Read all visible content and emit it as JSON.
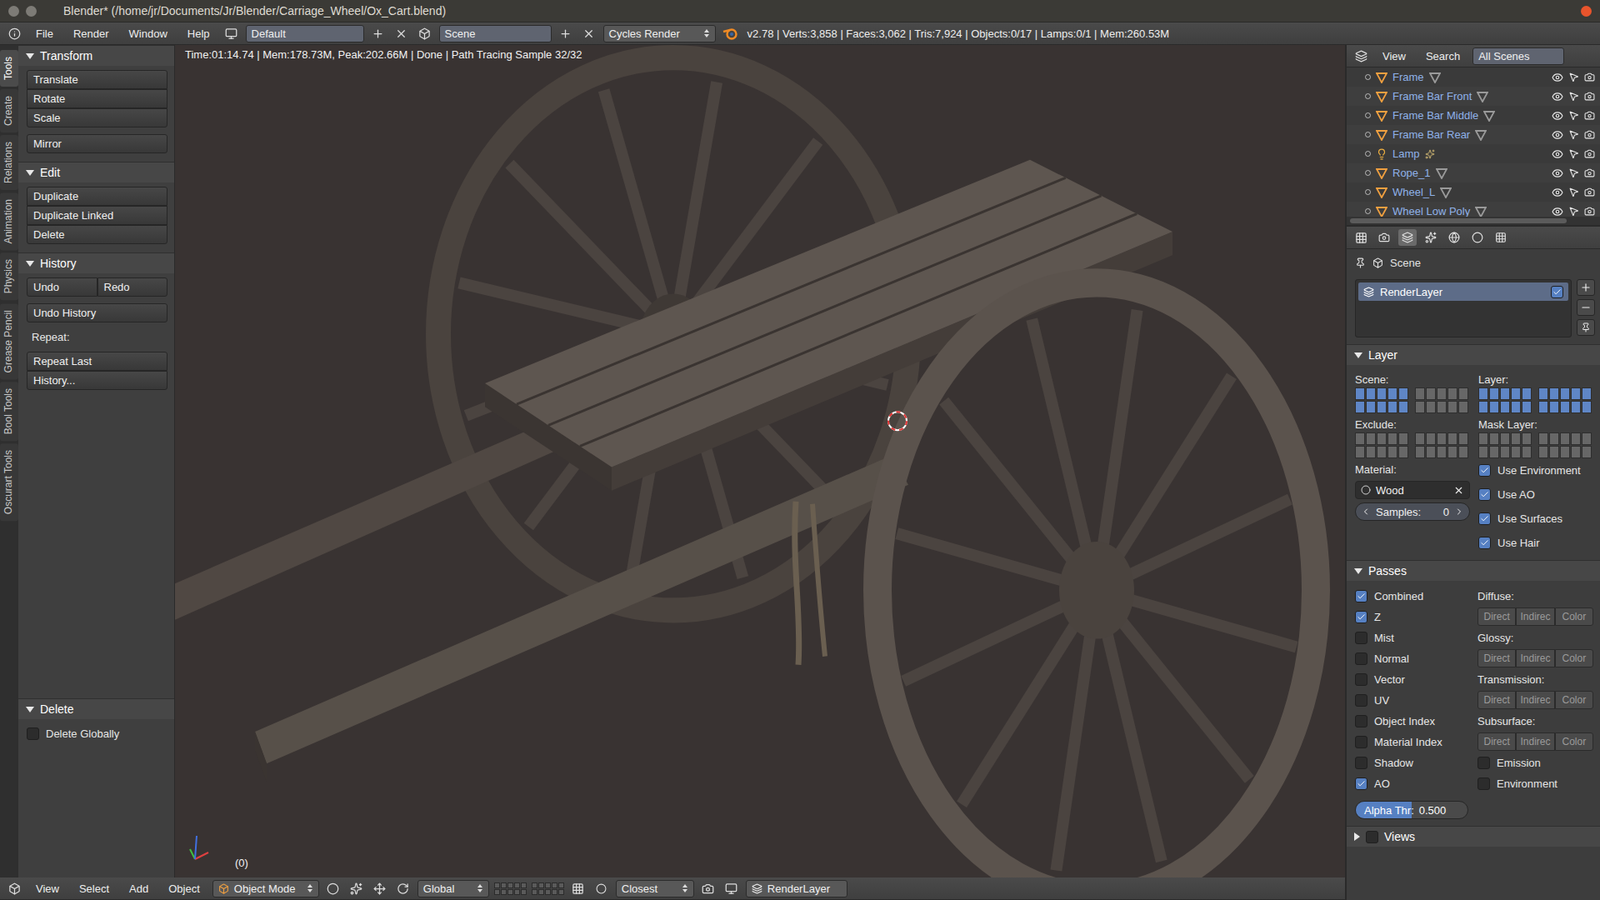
{
  "window": {
    "title": "Blender* (/home/jr/Documents/Jr/Blender/Carriage_Wheel/Ox_Cart.blend)"
  },
  "info_header": {
    "menus": [
      "File",
      "Render",
      "Window",
      "Help"
    ],
    "layout": "Default",
    "scene": "Scene",
    "engine": "Cycles Render",
    "stats": "v2.78 | Verts:3,858 | Faces:3,062 | Tris:7,924 | Objects:0/17 | Lamps:0/1 | Mem:260.53M"
  },
  "tool_tabs": [
    {
      "label": "Tools",
      "selected": true
    },
    {
      "label": "Create",
      "selected": false
    },
    {
      "label": "Relations",
      "selected": false
    },
    {
      "label": "Animation",
      "selected": false
    },
    {
      "label": "Physics",
      "selected": false
    },
    {
      "label": "Grease Pencil",
      "selected": false
    },
    {
      "label": "Bool Tools",
      "selected": false
    },
    {
      "label": "Oscurart Tools",
      "selected": false
    }
  ],
  "tool_shelf": {
    "panels": [
      {
        "title": "Transform",
        "expanded": true,
        "groups": [
          {
            "kind": "column",
            "items": [
              "Translate",
              "Rotate",
              "Scale"
            ]
          },
          {
            "kind": "column",
            "items": [
              "Mirror"
            ]
          }
        ]
      },
      {
        "title": "Edit",
        "expanded": true,
        "groups": [
          {
            "kind": "column",
            "items": [
              "Duplicate",
              "Duplicate Linked",
              "Delete"
            ]
          }
        ]
      },
      {
        "title": "History",
        "expanded": true,
        "groups": [
          {
            "kind": "row",
            "items": [
              "Undo",
              "Redo"
            ]
          },
          {
            "kind": "column",
            "items": [
              "Undo History"
            ]
          },
          {
            "kind": "label",
            "items": [
              "Repeat:"
            ]
          },
          {
            "kind": "column",
            "items": [
              "Repeat Last",
              "History..."
            ]
          }
        ]
      }
    ],
    "operator": {
      "title": "Delete",
      "expanded": true,
      "options": [
        {
          "label": "Delete Globally",
          "checked": false
        }
      ]
    }
  },
  "viewport": {
    "info": "Time:01:14.74 | Mem:178.73M, Peak:202.66M | Done | Path Tracing Sample 32/32",
    "frame": "(0)"
  },
  "bottom_header": {
    "menus": [
      "View",
      "Select",
      "Add",
      "Object"
    ],
    "mode": "Object Mode",
    "orientation": "Global",
    "snap": "Closest",
    "render_layer": "RenderLayer"
  },
  "outliner": {
    "menus": [
      "View",
      "Search"
    ],
    "display": "All Scenes",
    "items": [
      {
        "name": "Frame",
        "kind": "mesh"
      },
      {
        "name": "Frame Bar Front",
        "kind": "mesh"
      },
      {
        "name": "Frame Bar Middle",
        "kind": "mesh"
      },
      {
        "name": "Frame Bar Rear",
        "kind": "mesh"
      },
      {
        "name": "Lamp",
        "kind": "lamp"
      },
      {
        "name": "Rope_1",
        "kind": "mesh"
      },
      {
        "name": "Wheel_L",
        "kind": "mesh"
      },
      {
        "name": "Wheel Low Poly",
        "kind": "mesh"
      }
    ]
  },
  "properties": {
    "tabs": [
      {
        "selected": false
      },
      {
        "selected": true
      },
      {
        "selected": false
      },
      {
        "selected": false
      },
      {
        "selected": false
      },
      {
        "selected": false
      }
    ],
    "breadcrumb": "Scene",
    "render_layers": [
      {
        "name": "RenderLayer",
        "enabled": true,
        "selected": true
      }
    ],
    "layer_panel": {
      "title": "Layer",
      "expanded": true,
      "grids": [
        {
          "label": "Scene:",
          "layers": [
            true,
            true,
            true,
            true,
            true,
            true,
            true,
            true,
            true,
            true,
            false,
            false,
            false,
            false,
            false,
            false,
            false,
            false,
            false,
            false
          ]
        },
        {
          "label": "Layer:",
          "layers": [
            true,
            true,
            true,
            true,
            true,
            true,
            true,
            true,
            true,
            true,
            true,
            true,
            true,
            true,
            true,
            true,
            true,
            true,
            true,
            true
          ]
        },
        {
          "label": "Exclude:",
          "layers": [
            false,
            false,
            false,
            false,
            false,
            false,
            false,
            false,
            false,
            false,
            false,
            false,
            false,
            false,
            false,
            false,
            false,
            false,
            false,
            false
          ]
        },
        {
          "label": "Mask Layer:",
          "layers": [
            false,
            false,
            false,
            false,
            false,
            false,
            false,
            false,
            false,
            false,
            false,
            false,
            false,
            false,
            false,
            false,
            false,
            false,
            false,
            false
          ]
        }
      ],
      "material_label": "Material:",
      "material": "Wood",
      "samples_label": "Samples:",
      "samples": "0",
      "options": [
        {
          "label": "Use Environment",
          "checked": true
        },
        {
          "label": "Use AO",
          "checked": true
        },
        {
          "label": "Use Surfaces",
          "checked": true
        },
        {
          "label": "Use Hair",
          "checked": true
        }
      ]
    },
    "passes_panel": {
      "title": "Passes",
      "expanded": true,
      "passes": [
        {
          "label": "Combined",
          "checked": true
        },
        {
          "label": "Z",
          "checked": true
        },
        {
          "label": "Mist",
          "checked": false
        },
        {
          "label": "Normal",
          "checked": false
        },
        {
          "label": "Vector",
          "checked": false
        },
        {
          "label": "UV",
          "checked": false
        },
        {
          "label": "Object Index",
          "checked": false
        },
        {
          "label": "Material Index",
          "checked": false
        }
      ],
      "light_groups": [
        {
          "label": "Diffuse:",
          "buttons": [
            "Direct",
            "Indirec",
            "Color"
          ]
        },
        {
          "label": "Glossy:",
          "buttons": [
            "Direct",
            "Indirec",
            "Color"
          ]
        },
        {
          "label": "Transmission:",
          "buttons": [
            "Direct",
            "Indirec",
            "Color"
          ]
        },
        {
          "label": "Subsurface:",
          "buttons": [
            "Direct",
            "Indirec",
            "Color"
          ]
        }
      ],
      "extra_left": [
        {
          "label": "Shadow",
          "checked": false
        },
        {
          "label": "AO",
          "checked": true
        }
      ],
      "extra_right": [
        {
          "label": "Emission",
          "checked": false
        },
        {
          "label": "Environment",
          "checked": false
        }
      ],
      "alpha_label": "Alpha Thr:",
      "alpha": "0.500",
      "alpha_level": 0.5
    },
    "views_panel": {
      "title": "Views",
      "expanded": false,
      "checked": false
    }
  }
}
